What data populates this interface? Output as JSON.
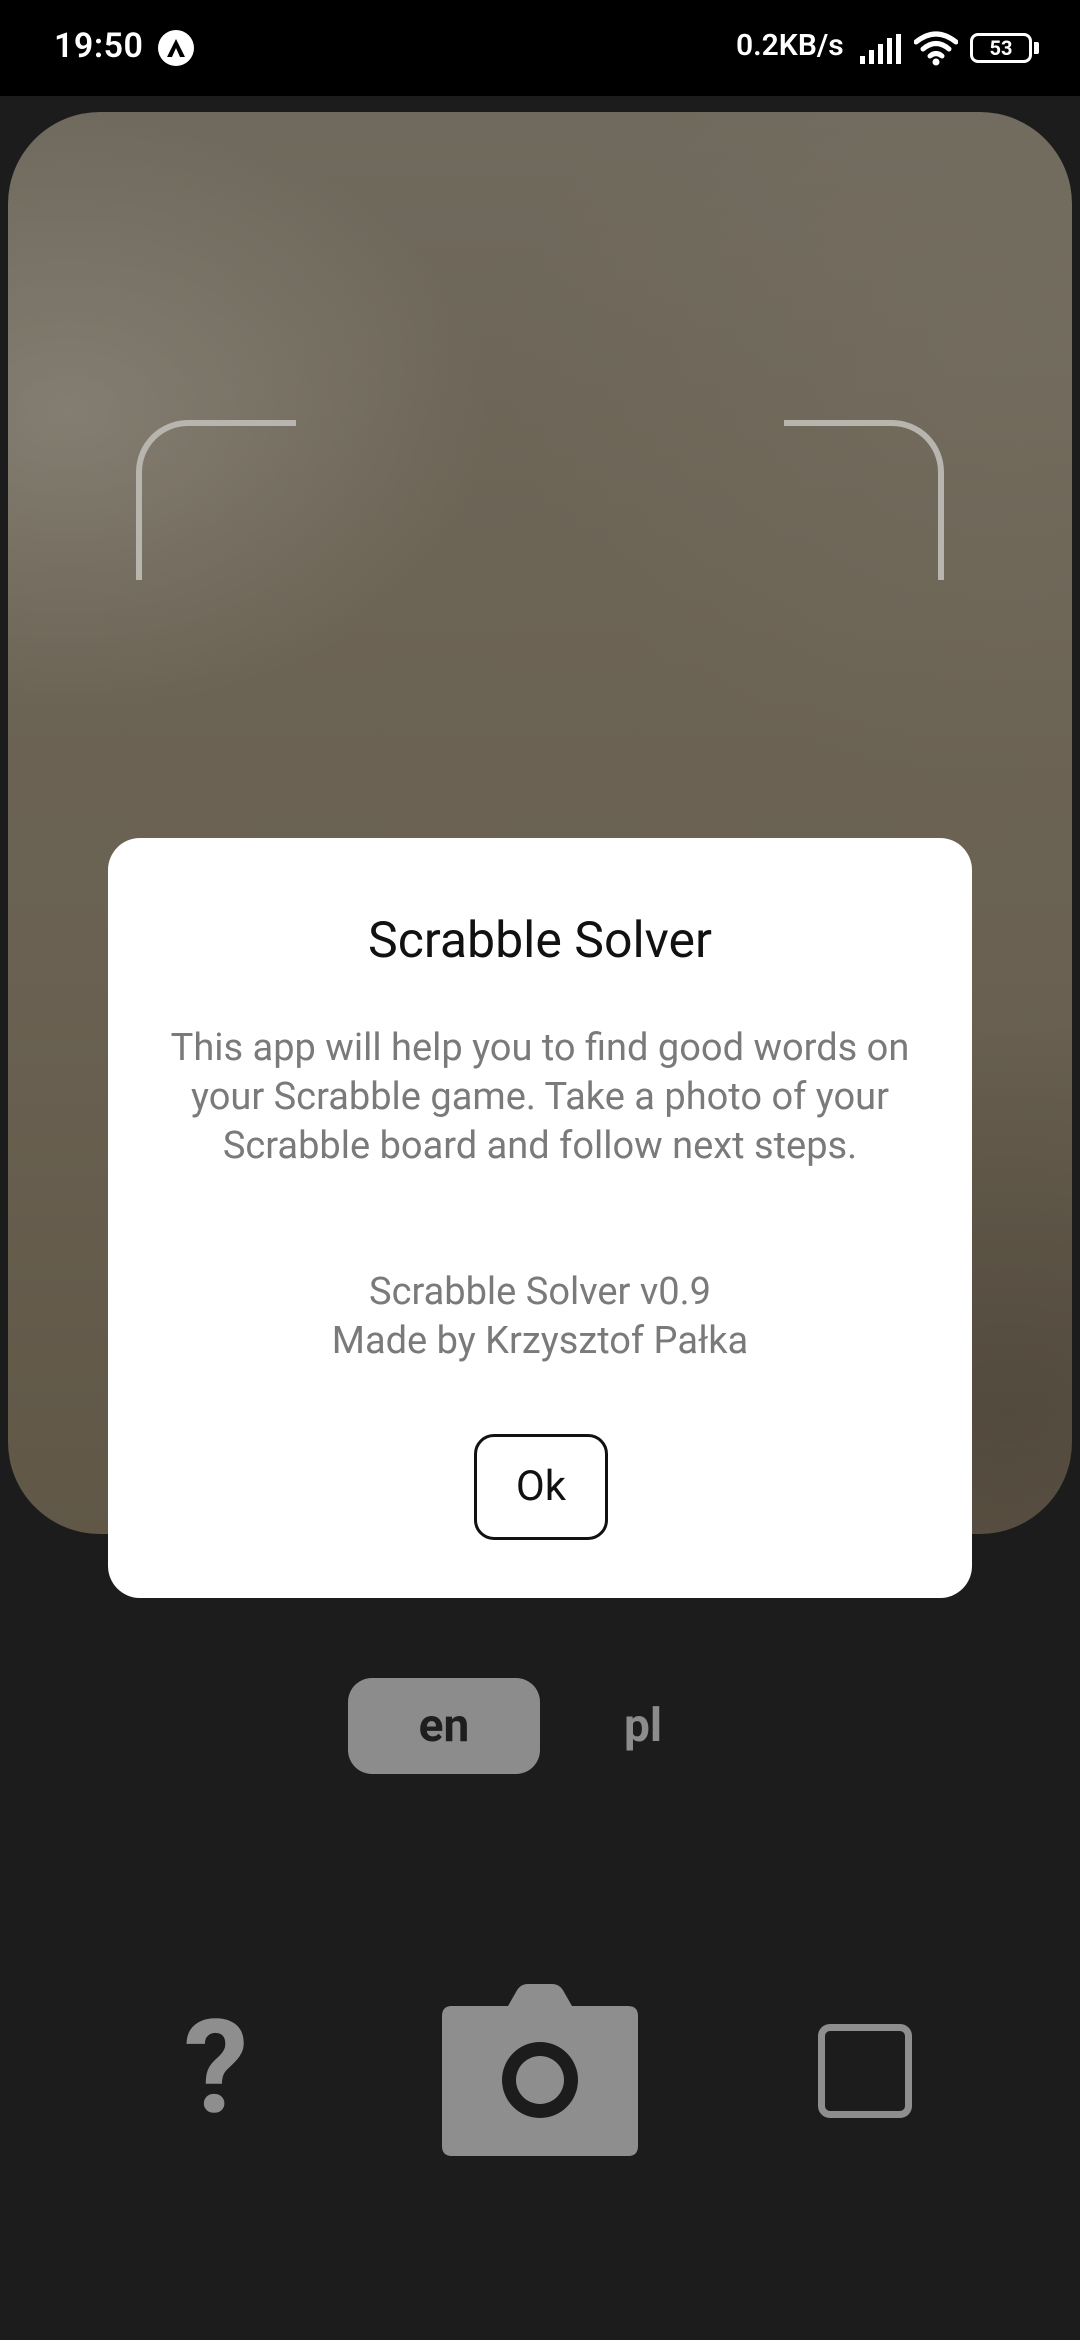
{
  "status_bar": {
    "time": "19:50",
    "network_speed": "0.2KB/s",
    "battery_level": "53",
    "app_icon": "a-circle-icon",
    "signal_icon": "signal-icon",
    "wifi_icon": "wifi-icon"
  },
  "dialog": {
    "title": "Scrabble Solver",
    "body": "This app will help you to find good words on your Scrabble game. Take a photo of your Scrabble board and follow next steps.",
    "version": "Scrabble Solver v0.9",
    "author": "Made by Krzysztof Pałka",
    "ok_label": "Ok"
  },
  "language": {
    "options": [
      "en",
      "pl"
    ],
    "selected": "en"
  },
  "toolbar": {
    "help_label": "?",
    "help_icon": "question-mark-icon",
    "camera_icon": "camera-icon",
    "square_icon": "square-icon"
  },
  "colors": {
    "background": "#1c1c1c",
    "dialog_bg": "#ffffff",
    "muted_text": "#7a7a7a",
    "control_gray": "#8e8e8e",
    "bracket": "#b8b4ae"
  }
}
